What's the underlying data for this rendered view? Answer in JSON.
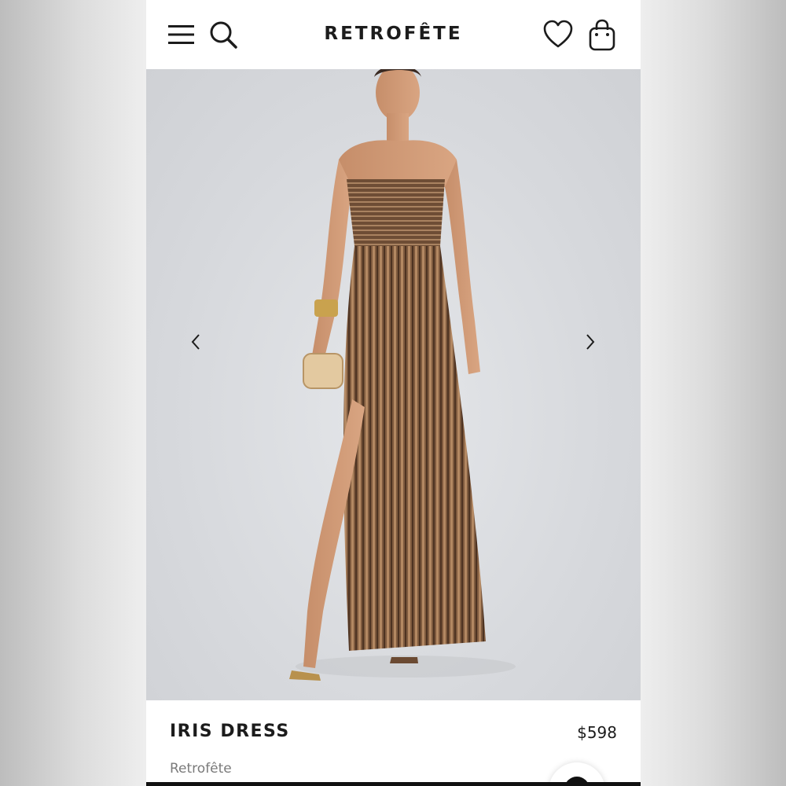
{
  "header": {
    "logo": "RETROFÊTE",
    "menu_icon": "hamburger-menu-icon",
    "search_icon": "search-icon",
    "wishlist_icon": "heart-icon",
    "bag_icon": "shopping-bag-icon"
  },
  "gallery": {
    "prev_icon": "chevron-left-icon",
    "next_icon": "chevron-right-icon",
    "image_subject": "model wearing metallic bronze pleated strapless gown"
  },
  "product": {
    "name": "IRIS DRESS",
    "price": "$598",
    "brand": "Retrofête"
  },
  "colors": {
    "text": "#1c1c1c",
    "muted": "#7a7a7a",
    "dress": "#8a6040"
  }
}
